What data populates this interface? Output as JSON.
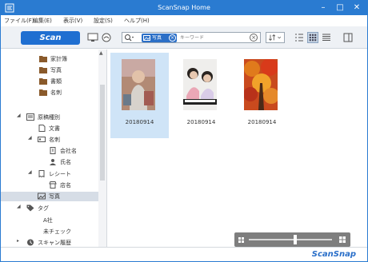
{
  "window": {
    "title": "ScanSnap Home"
  },
  "menu": [
    "ファイル(F)",
    "編集(E)",
    "表示(V)",
    "設定(S)",
    "ヘルプ(H)"
  ],
  "toolbar": {
    "scan_label": "Scan",
    "filter_tag": "写真",
    "search_placeholder": "キーワード"
  },
  "sidebar": {
    "folders": [
      "家計簿",
      "写真",
      "書類",
      "名刺"
    ],
    "doc_types_label": "原稿種別",
    "doc_types": {
      "document": "文書",
      "business_card": "名刺",
      "company_name": "会社名",
      "person_name": "氏名",
      "receipt": "レシート",
      "store_name": "店名",
      "photo": "写真"
    },
    "tags_label": "タグ",
    "tags": [
      "A社",
      "未チェック"
    ],
    "history_label": "スキャン履歴"
  },
  "content": {
    "items": [
      {
        "label": "20180914",
        "selected": true
      },
      {
        "label": "20180914",
        "selected": false
      },
      {
        "label": "20180914",
        "selected": false
      }
    ]
  },
  "footer": {
    "brand": "ScanSnap"
  },
  "colors": {
    "accent": "#2a7bd1",
    "scan_button": "#1f6fd1",
    "selection": "#cfe4f7"
  }
}
